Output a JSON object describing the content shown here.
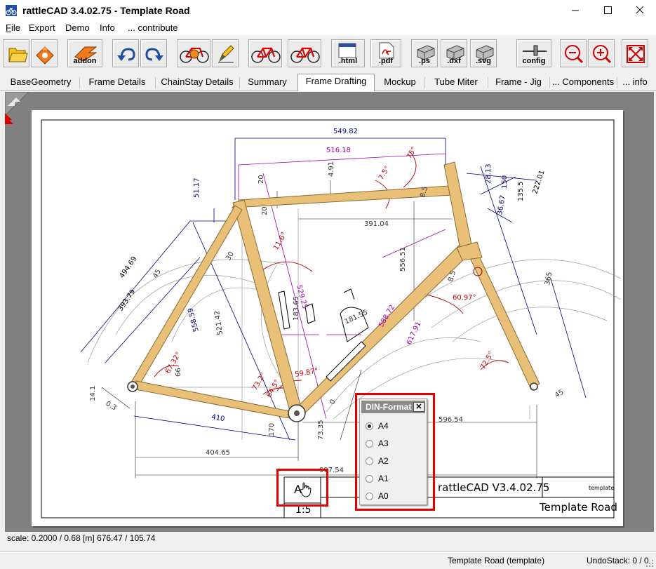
{
  "window": {
    "title": "rattleCAD  3.4.02.75 - Template Road",
    "app_icon": "bike-app-icon"
  },
  "window_controls": [
    "minimize-icon",
    "maximize-icon",
    "close-icon"
  ],
  "menu": [
    {
      "label": "File"
    },
    {
      "label": "Export"
    },
    {
      "label": "Demo"
    },
    {
      "label": "Info"
    },
    {
      "label": "... contribute"
    }
  ],
  "toolbar": {
    "addon_label": "addon",
    "html_label": ".html",
    "pdf_label": ".pdf",
    "ps_label": ".ps",
    "dxf_label": ".dxf",
    "svg_label": ".svg",
    "config_label": "config"
  },
  "tabs": [
    {
      "label": "BaseGeometry"
    },
    {
      "label": "Frame Details"
    },
    {
      "label": "ChainStay Details"
    },
    {
      "label": "Summary"
    },
    {
      "label": "Frame Drafting",
      "active": true
    },
    {
      "label": "Mockup"
    },
    {
      "label": "Tube Miter"
    },
    {
      "label": "Frame - Jig"
    },
    {
      "label": "... Components"
    },
    {
      "label": "... info"
    }
  ],
  "drawing": {
    "dimensions": {
      "top_width": "549.82",
      "inner_width": "516.18",
      "offset": "4.91",
      "reach": "391.04",
      "stack": "556.51",
      "seat_len": "529.25",
      "top_angle": "7.5°",
      "head_angle": "75°",
      "seat_angle_red": "11.6°",
      "d85a": "8.5",
      "d85b": "8.5",
      "d20a": "20",
      "d20b": "20",
      "d2813": "28.13",
      "d150": "150",
      "d3667": "36.67",
      "d22201": "222.01",
      "d1355": "135.5",
      "d365": "365",
      "d5117": "51.17",
      "d49469": "494.69",
      "d39379": "393.79",
      "d45": "45",
      "d30": "30",
      "d55859": "558.59",
      "d52142": "521.42",
      "d18365": "183.65",
      "d18155": "181.55",
      "d6732": "67.32°",
      "d66": "66",
      "d6097": "60.97°",
      "d58872": "588.72",
      "d61791": "617.91",
      "d7250": "72.5°",
      "d7323": "73.2°",
      "d6452": "64.5°",
      "d5987": "59.87°",
      "d0": "0",
      "d410": "410",
      "d40465": "404.65",
      "d99754": "997.54",
      "d59654": "596.54",
      "d45b": "45",
      "d1141": "14.1",
      "d03": "0.3",
      "d170": "170",
      "d7335": "73.35"
    },
    "title_block": {
      "format": "A4",
      "scale": "1:5",
      "app_version": "rattleCAD   V3.4.02.75",
      "small_label": "template",
      "project_name": "Template Road"
    }
  },
  "din_popup": {
    "title": "DIN-Format",
    "options": [
      {
        "label": "A4",
        "checked": true
      },
      {
        "label": "A3"
      },
      {
        "label": "A2"
      },
      {
        "label": "A1"
      },
      {
        "label": "A0"
      }
    ]
  },
  "status": {
    "scale_info": "scale: 0.2000 / 0.68  [m]  676.47 / 105.74",
    "project": "Template Road (template)",
    "undo": "UndoStack:  0 /  0"
  },
  "colors": {
    "tube": "#e9c078",
    "tube_edge": "#8a6a34",
    "dim_blue": "#00007a",
    "dim_magenta": "#a000b0",
    "dim_red": "#c00000",
    "highlight": "#e00000"
  }
}
